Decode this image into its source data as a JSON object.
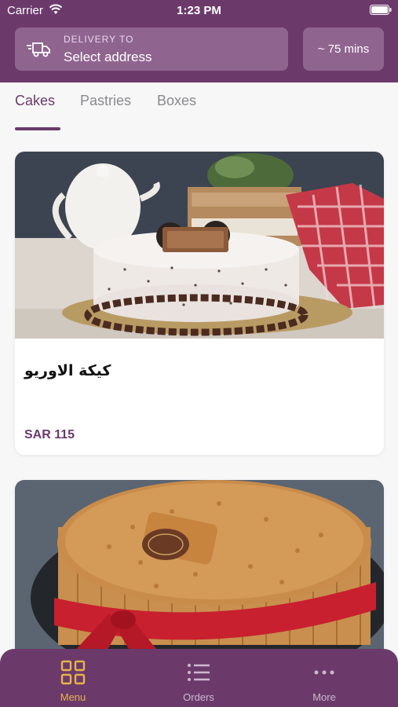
{
  "status_bar": {
    "carrier": "Carrier",
    "time": "1:23 PM"
  },
  "header": {
    "delivery_label": "DELIVERY TO",
    "address_value": "Select address",
    "delivery_time": "~ 75 mins"
  },
  "tabs": [
    {
      "label": "Cakes",
      "active": true
    },
    {
      "label": "Pastries",
      "active": false
    },
    {
      "label": "Boxes",
      "active": false
    }
  ],
  "products": [
    {
      "title": "كيكة الاوريو",
      "price": "SAR 115"
    },
    {
      "title": "",
      "price": ""
    }
  ],
  "tabbar": [
    {
      "label": "Menu",
      "icon": "grid-icon",
      "active": true
    },
    {
      "label": "Orders",
      "icon": "list-icon",
      "active": false
    },
    {
      "label": "More",
      "icon": "more-icon",
      "active": false
    }
  ],
  "colors": {
    "brand": "#6b3a6b",
    "accent": "#e6b34a",
    "price": "#6b3a6b"
  }
}
